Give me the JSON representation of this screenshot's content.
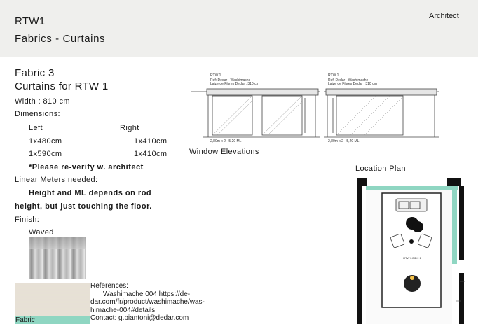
{
  "header": {
    "title": "RTW1",
    "subtitle": "Fabrics - Curtains",
    "role": "Architect"
  },
  "spec": {
    "fabric_name": "Fabric 3",
    "curtains_for": "Curtains for RTW 1",
    "width": "Width : 810 cm",
    "dimensions_label": "Dimensions:",
    "left_label": "Left",
    "right_label": "Right",
    "rows": [
      {
        "left": "1x480cm",
        "right": "1x410cm"
      },
      {
        "left": "1x590cm",
        "right": "1x410cm"
      }
    ],
    "verify_note": "*Please re-verify w. architect",
    "linear_label": "Linear Meters needed:",
    "linear_note_1": "Height and ML depends on rod",
    "linear_note_2": "height, but just touching the floor.",
    "finish_label": "Finish:",
    "finish_value": "Waved"
  },
  "elevations": {
    "caption": "Window Elevations",
    "items": [
      {
        "title": "RTW 1",
        "line1": "Ref: Dedar - Washimache",
        "line2": "Laize de Fibres Dedar : 310 cm",
        "bottom": "2,80m x 2 - 5,20 ML"
      },
      {
        "title": "RTW 1",
        "line1": "Ref: Dedar - Washimache",
        "line2": "Laize de Fibres Dedar : 310 cm",
        "bottom": "2,80m x 2 - 5,20 ML"
      }
    ]
  },
  "location": {
    "title": "Location Plan",
    "room_label": "RTW LINDH 1",
    "accent": "#8fd6c2"
  },
  "references": {
    "title": "References:",
    "line1": "Washimache 004 https://de-",
    "line2": "dar.com/fr/product/washimache/was-",
    "line3": "himache-004#details",
    "contact": "Contact: g.piantoni@dedar.com"
  },
  "fabric_tag": "Fabric"
}
